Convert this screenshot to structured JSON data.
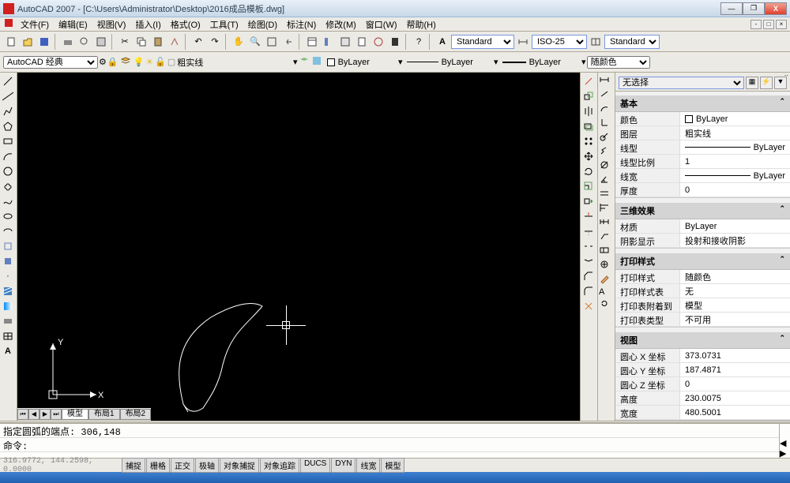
{
  "window": {
    "title": "AutoCAD 2007 - [C:\\Users\\Administrator\\Desktop\\2016成品模板.dwg]"
  },
  "menus": [
    "文件(F)",
    "编辑(E)",
    "视图(V)",
    "插入(I)",
    "格式(O)",
    "工具(T)",
    "绘图(D)",
    "标注(N)",
    "修改(M)",
    "窗口(W)",
    "帮助(H)"
  ],
  "style_combo1": "Standard",
  "style_combo2": "ISO-25",
  "style_combo3": "Standard",
  "workspace": "AutoCAD 经典",
  "layer_combo": "粗实线",
  "color_combo": "ByLayer",
  "linetype_combo": "ByLayer",
  "lineweight_combo": "ByLayer",
  "plot_combo": "随颜色",
  "tabs": {
    "model": "模型",
    "layout1": "布局1",
    "layout2": "布局2"
  },
  "props": {
    "selector": "无选择",
    "section_basic": "基本",
    "rows_basic": [
      {
        "k": "颜色",
        "v": "ByLayer",
        "swatch": true
      },
      {
        "k": "图层",
        "v": "粗实线"
      },
      {
        "k": "线型",
        "v": "ByLayer",
        "line": true
      },
      {
        "k": "线型比例",
        "v": "1"
      },
      {
        "k": "线宽",
        "v": "ByLayer",
        "line": true
      },
      {
        "k": "厚度",
        "v": "0"
      }
    ],
    "section_3d": "三维效果",
    "rows_3d": [
      {
        "k": "材质",
        "v": "ByLayer"
      },
      {
        "k": "阴影显示",
        "v": "投射和接收阴影"
      }
    ],
    "section_plot": "打印样式",
    "rows_plot": [
      {
        "k": "打印样式",
        "v": "随颜色"
      },
      {
        "k": "打印样式表",
        "v": "无"
      },
      {
        "k": "打印表附着到",
        "v": "模型"
      },
      {
        "k": "打印表类型",
        "v": "不可用"
      }
    ],
    "section_view": "视图",
    "rows_view": [
      {
        "k": "圆心 X 坐标",
        "v": "373.0731"
      },
      {
        "k": "圆心 Y 坐标",
        "v": "187.4871"
      },
      {
        "k": "圆心 Z 坐标",
        "v": "0"
      },
      {
        "k": "高度",
        "v": "230.0075"
      },
      {
        "k": "宽度",
        "v": "480.5001"
      }
    ]
  },
  "cmd": {
    "line1": "指定圆弧的端点: 306,148",
    "prompt": "命令:"
  },
  "status": {
    "coord": "316.9772, 144.2598, 0.0000",
    "buttons": [
      "捕捉",
      "栅格",
      "正交",
      "极轴",
      "对象捕捉",
      "对象追踪",
      "DUCS",
      "DYN",
      "线宽",
      "模型"
    ]
  },
  "ucs_labels": {
    "x": "X",
    "y": "Y"
  }
}
